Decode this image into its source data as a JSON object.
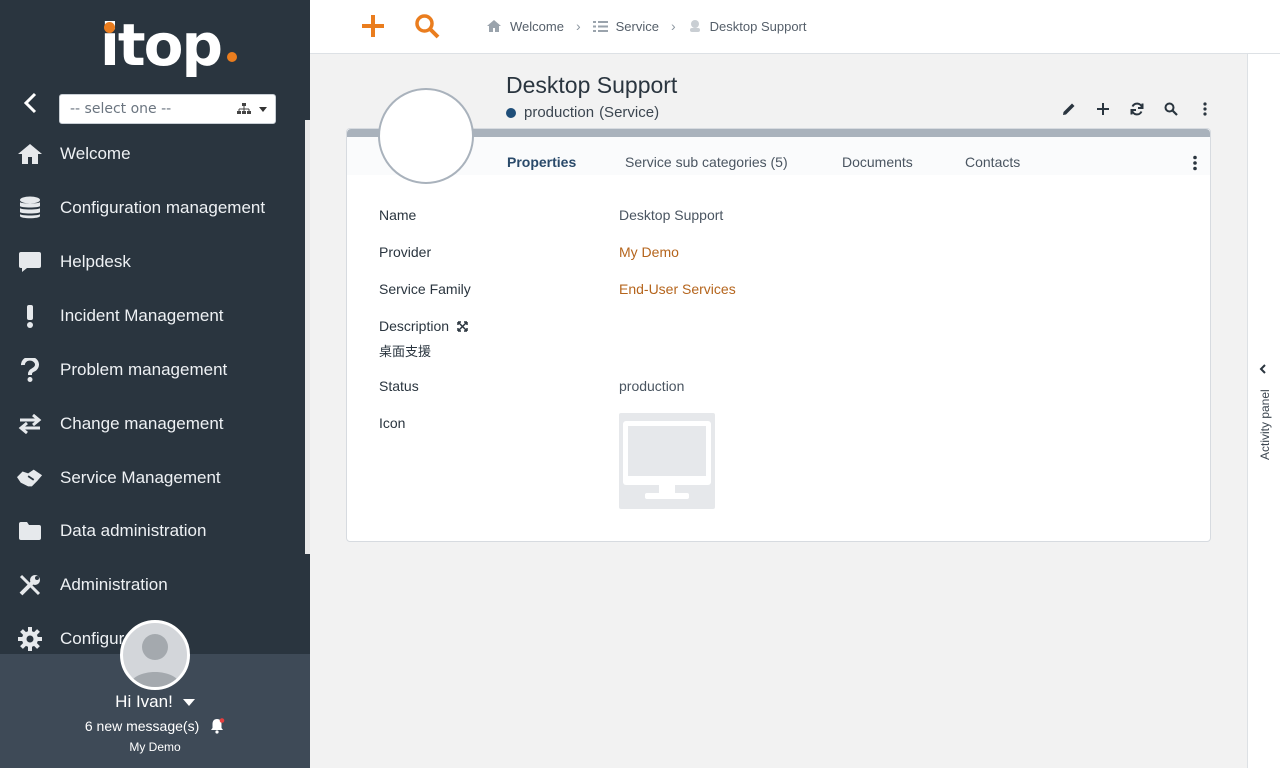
{
  "app": {
    "logo_text": "itop",
    "accent_color": "#ea7d1e",
    "link_color": "#b5651d"
  },
  "sidebar": {
    "org_select": {
      "placeholder": "-- select one --"
    },
    "items": [
      {
        "label": "Welcome",
        "icon": "home-icon"
      },
      {
        "label": "Configuration management",
        "icon": "database-icon"
      },
      {
        "label": "Helpdesk",
        "icon": "chat-icon"
      },
      {
        "label": "Incident Management",
        "icon": "exclamation-icon"
      },
      {
        "label": "Problem management",
        "icon": "question-icon"
      },
      {
        "label": "Change management",
        "icon": "exchange-icon"
      },
      {
        "label": "Service Management",
        "icon": "handshake-icon"
      },
      {
        "label": "Data administration",
        "icon": "folder-icon"
      },
      {
        "label": "Administration",
        "icon": "tools-icon"
      },
      {
        "label": "Configur",
        "icon": "gear-icon"
      }
    ],
    "user": {
      "greeting": "Hi Ivan!",
      "messages": "6 new message(s)",
      "organization": "My Demo"
    }
  },
  "topbar": {
    "breadcrumb": [
      {
        "label": "Welcome",
        "icon": "home-icon"
      },
      {
        "label": "Service",
        "icon": "list-icon"
      },
      {
        "label": "Desktop Support",
        "icon": "service-icon"
      }
    ]
  },
  "object": {
    "title": "Desktop Support",
    "status": "production",
    "class": "(Service)",
    "tabs": [
      {
        "label": "Properties",
        "active": true
      },
      {
        "label": "Service sub categories (5)",
        "active": false
      },
      {
        "label": "Documents",
        "active": false
      },
      {
        "label": "Contacts",
        "active": false
      }
    ],
    "fields": {
      "name_label": "Name",
      "name_value": "Desktop Support",
      "provider_label": "Provider",
      "provider_value": "My Demo",
      "family_label": "Service Family",
      "family_value": "End-User Services",
      "description_label": "Description",
      "description_value": "桌面支援",
      "status_label": "Status",
      "status_value": "production",
      "icon_label": "Icon"
    }
  },
  "activity_panel": {
    "label": "Activity panel"
  }
}
